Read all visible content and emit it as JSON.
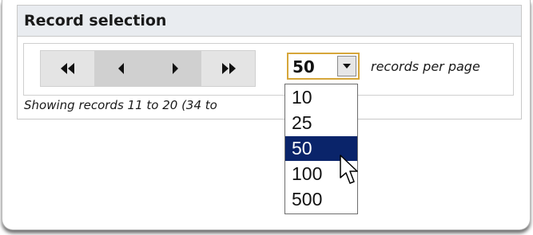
{
  "record_selection": {
    "title": "Record selection",
    "pager": {
      "first_icon": "double-left-arrow-icon",
      "prev_icon": "left-arrow-icon",
      "next_icon": "right-arrow-icon",
      "last_icon": "double-right-arrow-icon"
    },
    "records_per_page": {
      "selected": "50",
      "label": "records per page",
      "options": [
        "10",
        "25",
        "50",
        "100",
        "500"
      ],
      "highlighted_option": "50"
    },
    "showing_text": "Showing records 11 to 20 (34 to"
  },
  "colors": {
    "header_bg": "#e9ecf0",
    "pager_bg": "#e4e4e4",
    "select_focus_border": "#d6a63a",
    "selected_option_bg": "#0a246a",
    "selected_option_text": "#ffffff"
  }
}
